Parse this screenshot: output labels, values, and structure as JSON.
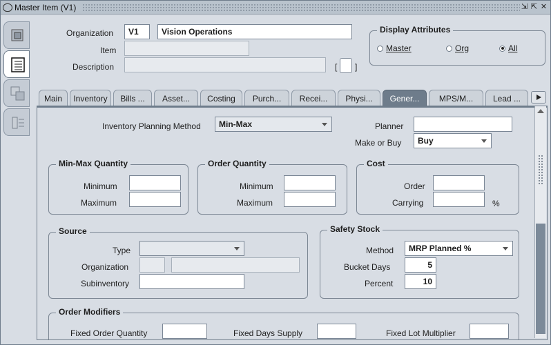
{
  "window": {
    "title": "Master Item (V1)",
    "controls": [
      "minimize-icon",
      "maximize-icon",
      "close-icon"
    ]
  },
  "header": {
    "org_label": "Organization",
    "org_code": "V1",
    "org_name": "Vision Operations",
    "item_label": "Item",
    "item_value": "",
    "description_label": "Description",
    "description_value": "",
    "bracket_left": "[",
    "bracket_right": "]"
  },
  "display_attributes": {
    "title": "Display Attributes",
    "options": [
      {
        "label": "Master",
        "selected": false
      },
      {
        "label": "Org",
        "selected": false
      },
      {
        "label": "All",
        "selected": true
      }
    ]
  },
  "left_tabs": [
    "item-detail-icon",
    "list-icon",
    "image-icon",
    "tree-icon"
  ],
  "tabs": [
    "Main",
    "Inventory",
    "Bills ...",
    "Asset...",
    "Costing",
    "Purch...",
    "Recei...",
    "Physi...",
    "Gener...",
    "MPS/M...",
    "Lead ..."
  ],
  "active_tab": "Gener...",
  "general_planning": {
    "inventory_planning_method_label": "Inventory Planning Method",
    "inventory_planning_method": "Min-Max",
    "planner_label": "Planner",
    "planner": "",
    "make_or_buy_label": "Make or Buy",
    "make_or_buy": "Buy",
    "minmax": {
      "title": "Min-Max Quantity",
      "min_label": "Minimum",
      "max_label": "Maximum",
      "min": "",
      "max": ""
    },
    "order_qty": {
      "title": "Order Quantity",
      "min_label": "Minimum",
      "max_label": "Maximum",
      "min": "",
      "max": ""
    },
    "cost": {
      "title": "Cost",
      "order_label": "Order",
      "carrying_label": "Carrying",
      "order": "",
      "carrying": "",
      "percent_sign": "%"
    },
    "source": {
      "title": "Source",
      "type_label": "Type",
      "organization_label": "Organization",
      "subinventory_label": "Subinventory",
      "type": "",
      "organization": "",
      "subinventory": ""
    },
    "safety_stock": {
      "title": "Safety Stock",
      "method_label": "Method",
      "method": "MRP Planned %",
      "bucket_days_label": "Bucket Days",
      "bucket_days": "5",
      "percent_label": "Percent",
      "percent": "10"
    },
    "order_modifiers": {
      "title": "Order Modifiers",
      "fixed_order_qty_label": "Fixed Order Quantity",
      "fixed_days_supply_label": "Fixed Days Supply",
      "fixed_lot_multiplier_label": "Fixed Lot Multiplier"
    }
  }
}
